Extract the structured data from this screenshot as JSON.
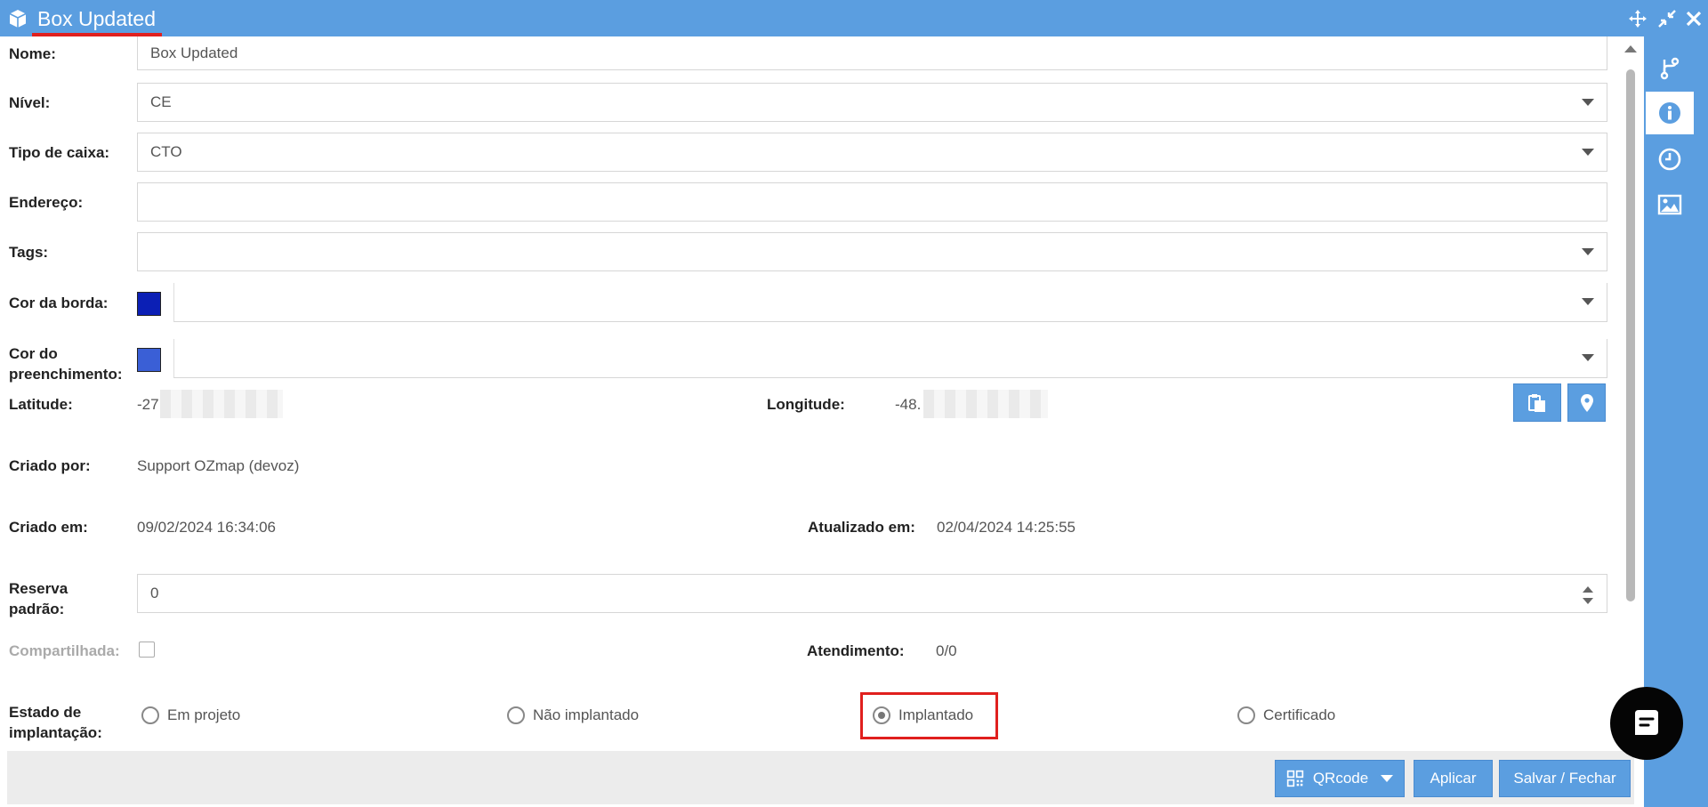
{
  "window": {
    "title": "Box Updated",
    "accent_color": "#5b9ee0",
    "controls": [
      "move-icon",
      "collapse-icon",
      "close-icon"
    ]
  },
  "sidebar": {
    "items": [
      {
        "icon": "branch-icon",
        "active": false
      },
      {
        "icon": "info-icon",
        "active": true
      },
      {
        "icon": "clock-icon",
        "active": false
      },
      {
        "icon": "image-icon",
        "active": false
      }
    ]
  },
  "form": {
    "nome": {
      "label": "Nome:",
      "value": "Box Updated"
    },
    "nivel": {
      "label": "Nível:",
      "value": "CE"
    },
    "tipo_caixa": {
      "label": "Tipo de caixa:",
      "value": "CTO"
    },
    "endereco": {
      "label": "Endereço:",
      "value": ""
    },
    "tags": {
      "label": "Tags:",
      "value": ""
    },
    "cor_borda": {
      "label": "Cor da borda:",
      "color": "#0b1fb5",
      "value": ""
    },
    "cor_preenchimento": {
      "label_line1": "Cor do",
      "label_line2": "preenchimento:",
      "color": "#3a5fd6",
      "value": ""
    },
    "latitude": {
      "label": "Latitude:",
      "value": "-27"
    },
    "longitude": {
      "label": "Longitude:",
      "value": "-48."
    },
    "criado_por": {
      "label": "Criado por:",
      "value": "Support OZmap (devoz)"
    },
    "criado_em": {
      "label": "Criado em:",
      "value": "09/02/2024 16:34:06"
    },
    "atualizado_em": {
      "label": "Atualizado em:",
      "value": "02/04/2024 14:25:55"
    },
    "reserva_padrao": {
      "label_line1": "Reserva",
      "label_line2": "padrão:",
      "value": "0"
    },
    "compartilhada": {
      "label": "Compartilhada:",
      "checked": false
    },
    "atendimento": {
      "label": "Atendimento:",
      "value": "0/0"
    },
    "estado_implantacao": {
      "label_line1": "Estado de",
      "label_line2": "implantação:",
      "options": [
        "Em projeto",
        "Não implantado",
        "Implantado",
        "Certificado"
      ],
      "selected": "Implantado"
    }
  },
  "footer": {
    "qrcode_label": "QRcode",
    "apply_label": "Aplicar",
    "save_close_label": "Salvar / Fechar"
  }
}
